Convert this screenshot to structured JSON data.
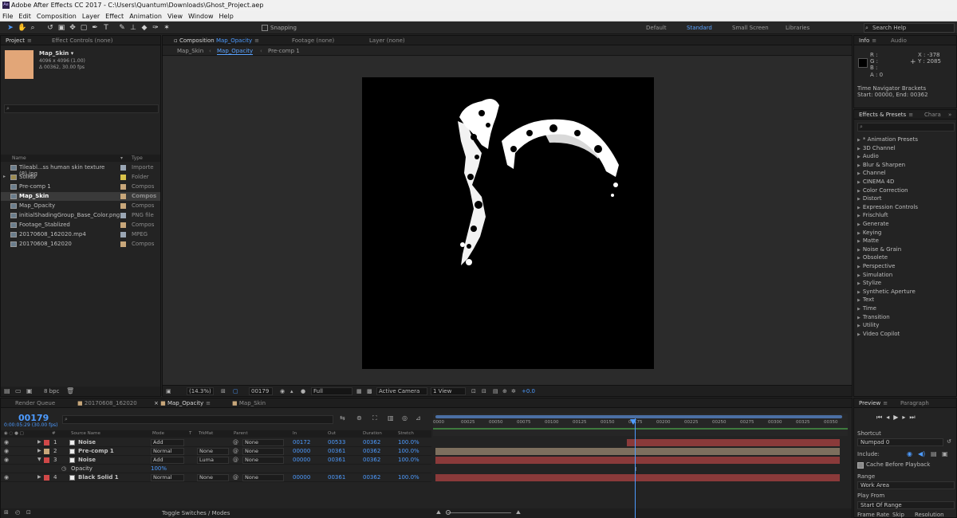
{
  "app": {
    "title": "Adobe After Effects CC 2017 - C:\\Users\\Quantum\\Downloads\\Ghost_Project.aep"
  },
  "menu": [
    "File",
    "Edit",
    "Composition",
    "Layer",
    "Effect",
    "Animation",
    "View",
    "Window",
    "Help"
  ],
  "toolbar": {
    "snapping": "Snapping",
    "workspaces": [
      "Default",
      "Standard",
      "Small Screen",
      "Libraries"
    ],
    "search_help": "Search Help"
  },
  "project": {
    "tabs": [
      "Project",
      "Effect Controls (none)"
    ],
    "item_name": "Map_Skin ▾",
    "item_size": "4096 x 4096 (1.00)",
    "item_duration": "Δ 00362, 30.00 fps",
    "col_name": "Name",
    "col_type": "Type",
    "items": [
      {
        "name": "Tileabl...ss human skin texture (8).jpg",
        "type": "Importe",
        "label": "#9aa6b4"
      },
      {
        "name": "Solids",
        "type": "Folder",
        "label": "#d8c24a"
      },
      {
        "name": "Pre-comp 1",
        "type": "Compos",
        "label": "#c8a77a"
      },
      {
        "name": "Map_Skin",
        "type": "Compos",
        "label": "#c8a77a"
      },
      {
        "name": "Map_Opacity",
        "type": "Compos",
        "label": "#c8a77a"
      },
      {
        "name": "initialShadingGroup_Base_Color.png",
        "type": "PNG file",
        "label": "#9aa6b4"
      },
      {
        "name": "Footage_Stablized",
        "type": "Compos",
        "label": "#c8a77a"
      },
      {
        "name": "20170608_162020.mp4",
        "type": "MPEG",
        "label": "#9aa6b4"
      },
      {
        "name": "20170608_162020",
        "type": "Compos",
        "label": "#c8a77a"
      }
    ],
    "bpc": "8 bpc"
  },
  "composition": {
    "tab_prefix": "Composition",
    "tab_name": "Map_Opacity",
    "other_tabs": [
      "Footage (none)",
      "Layer (none)"
    ],
    "breadcrumbs": [
      "Map_Skin",
      "Map_Opacity",
      "Pre-comp 1"
    ],
    "footer": {
      "zoom": "(14.3%)",
      "timecode": "00179",
      "resolution": "Full",
      "camera": "Active Camera",
      "views": "1 View",
      "exposure": "+0.0"
    }
  },
  "info": {
    "tabs": [
      "Info",
      "Audio"
    ],
    "r": "R :",
    "g": "G :",
    "b": "B :",
    "a": "A : 0",
    "x": "X : -378",
    "y": "Y : 2085",
    "nav_title": "Time Navigator Brackets",
    "nav_range": "Start: 00000, End: 00362"
  },
  "effects": {
    "tabs": [
      "Effects & Presets",
      "Chara"
    ],
    "items": [
      "* Animation Presets",
      "3D Channel",
      "Audio",
      "Blur & Sharpen",
      "Channel",
      "CINEMA 4D",
      "Color Correction",
      "Distort",
      "Expression Controls",
      "Frischluft",
      "Generate",
      "Keying",
      "Matte",
      "Noise & Grain",
      "Obsolete",
      "Perspective",
      "Simulation",
      "Stylize",
      "Synthetic Aperture",
      "Text",
      "Time",
      "Transition",
      "Utility",
      "Video Copilot"
    ]
  },
  "timeline": {
    "tabs": [
      "Render Queue",
      "20170608_162020",
      "Map_Opacity",
      "Map_Skin"
    ],
    "timecode": "00179",
    "timecode_sub": "0:00:05:29 (30.00 fps)",
    "headers": {
      "num": "#",
      "source": "Source Name",
      "mode": "Mode",
      "t": "T",
      "trkmat": "TrkMat",
      "parent": "Parent",
      "in": "In",
      "out": "Out",
      "duration": "Duration",
      "stretch": "Stretch"
    },
    "layers": [
      {
        "num": "1",
        "name": "Noise",
        "mode": "Add",
        "trkmat": "",
        "parent": "None",
        "in": "00172",
        "out": "00533",
        "duration": "00362",
        "stretch": "100.0%",
        "label": "#d04848",
        "bar": "#8a3a3a"
      },
      {
        "num": "2",
        "name": "Pre-comp 1",
        "mode": "Normal",
        "trkmat": "None",
        "parent": "None",
        "in": "00000",
        "out": "00361",
        "duration": "00362",
        "stretch": "100.0%",
        "label": "#c8a77a",
        "bar": "#7d6f5e"
      },
      {
        "num": "3",
        "name": "Noise",
        "mode": "Add",
        "trkmat": "Luma",
        "parent": "None",
        "in": "00000",
        "out": "00361",
        "duration": "00362",
        "stretch": "100.0%",
        "label": "#d04848",
        "bar": "#8a3a3a"
      },
      {
        "num": "4",
        "name": "Black Solid 1",
        "mode": "Normal",
        "trkmat": "None",
        "parent": "None",
        "in": "00000",
        "out": "00361",
        "duration": "00362",
        "stretch": "100.0%",
        "label": "#d04848",
        "bar": "#8a3a3a"
      }
    ],
    "opacity_label": "Opacity",
    "opacity_value": "100%",
    "ticks": [
      "0000",
      "00025",
      "00050",
      "00075",
      "00100",
      "00125",
      "00150",
      "00175",
      "00200",
      "00225",
      "00250",
      "00275",
      "00300",
      "00325",
      "00350"
    ],
    "toggle": "Toggle Switches / Modes"
  },
  "preview": {
    "tabs": [
      "Preview",
      "Paragraph"
    ],
    "shortcut_label": "Shortcut",
    "shortcut_value": "Numpad 0",
    "include_label": "Include:",
    "cache": "Cache Before Playback",
    "range_label": "Range",
    "range_value": "Work Area",
    "play_from_label": "Play From",
    "play_from_value": "Start Of Range",
    "bottom": [
      "Frame Rate",
      "Skip",
      "Resolution"
    ]
  }
}
